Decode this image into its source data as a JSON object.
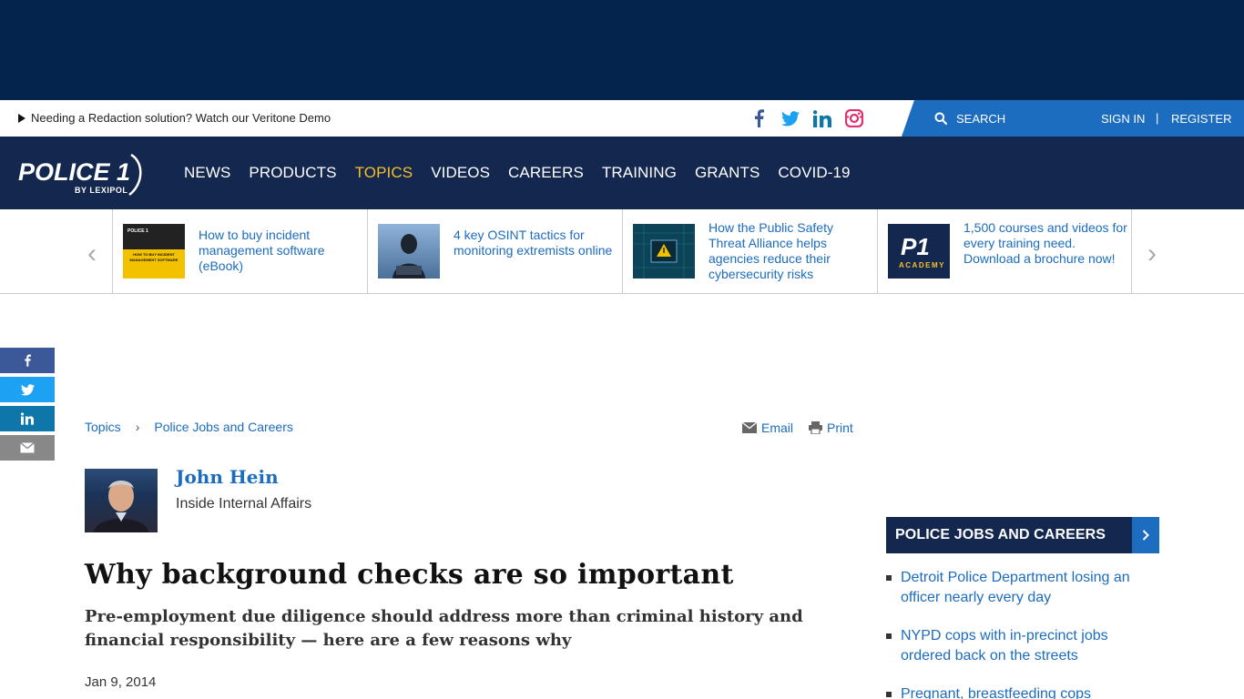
{
  "utility": {
    "promo_text": "Needing a Redaction solution? Watch our Veritone Demo",
    "search_label": "SEARCH",
    "sign_in": "SIGN IN",
    "separator": "|",
    "register": "REGISTER"
  },
  "logo": {
    "main": "POLICE 1",
    "sub": "BY LEXIPOL"
  },
  "nav": {
    "items": [
      {
        "label": "NEWS"
      },
      {
        "label": "PRODUCTS"
      },
      {
        "label": "TOPICS"
      },
      {
        "label": "VIDEOS"
      },
      {
        "label": "CAREERS"
      },
      {
        "label": "TRAINING"
      },
      {
        "label": "GRANTS"
      },
      {
        "label": "COVID-19"
      }
    ],
    "active_color": "#f5c02a"
  },
  "carousel": {
    "items": [
      {
        "title": "How to buy incident management software (eBook)"
      },
      {
        "title": "4 key OSINT tactics for monitoring extremists online"
      },
      {
        "title": "How the Public Safety Threat Alliance helps agencies reduce their cybersecurity risks"
      },
      {
        "title": "1,500 courses and videos for every training need. Download a brochure now!"
      }
    ],
    "thumb_labels": {
      "ebook_brand": "POLICE 1",
      "ebook_title": "HOW TO BUY INCIDENT MANAGEMENT SOFTWARE",
      "academy_main": "P1",
      "academy_sub": "ACADEMY"
    }
  },
  "breadcrumb": {
    "topics": "Topics",
    "section": "Police Jobs and Careers"
  },
  "tools": {
    "email": "Email",
    "print": "Print"
  },
  "author": {
    "name": "John Hein",
    "column": "Inside Internal Affairs"
  },
  "article": {
    "headline": "Why background checks are so important",
    "subhead": "Pre-employment due diligence should address more than criminal history and financial responsibility — here are a few reasons why",
    "date": "Jan 9, 2014"
  },
  "sidebar": {
    "heading": "POLICE JOBS AND CAREERS",
    "items": [
      {
        "title": "Detroit Police Department losing an officer nearly every day"
      },
      {
        "title": "NYPD cops with in-precinct jobs ordered back on the streets"
      },
      {
        "title": "Pregnant, breastfeeding cops"
      }
    ]
  },
  "colors": {
    "brand_navy": "#13274f",
    "ad_navy": "#04244d",
    "link_blue": "#1c6cbf",
    "accent_yellow": "#f5c02a",
    "facebook": "#3b5998",
    "twitter": "#1da1f2",
    "linkedin": "#0e76a8",
    "instagram": "#e1306c"
  }
}
